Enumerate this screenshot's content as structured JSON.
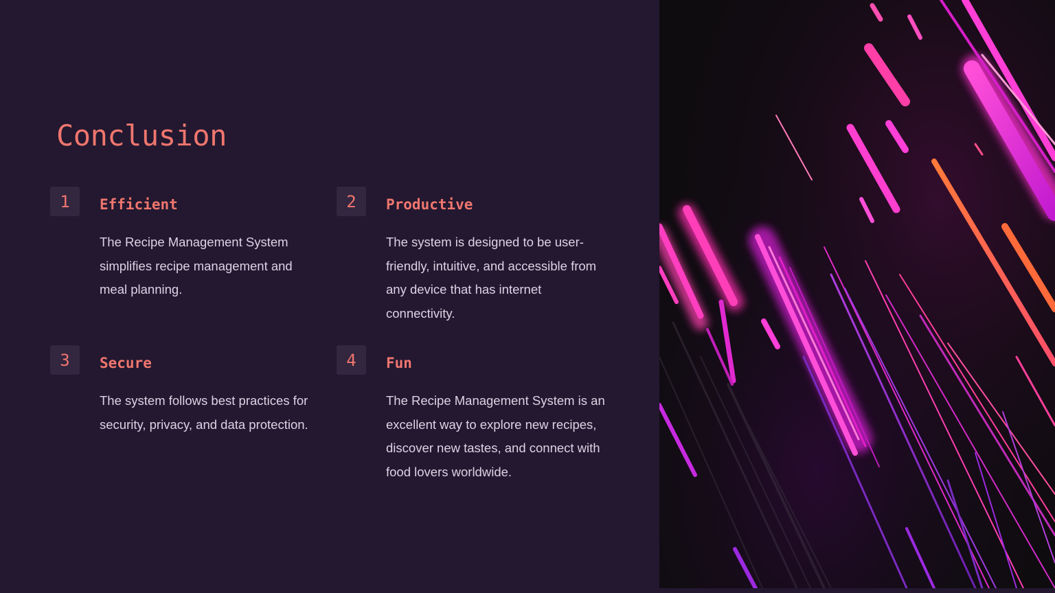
{
  "slide": {
    "title": "Conclusion",
    "items": [
      {
        "number": "1",
        "heading": "Efficient",
        "body": "The Recipe Management System simplifies recipe management and meal planning."
      },
      {
        "number": "2",
        "heading": "Productive",
        "body": "The system is designed to be user-friendly, intuitive, and accessible from any device that has internet connectivity."
      },
      {
        "number": "3",
        "heading": "Secure",
        "body": "The system follows best practices for security, privacy, and data protection."
      },
      {
        "number": "4",
        "heading": "Fun",
        "body": "The Recipe Management System is an excellent way to explore new recipes, discover new tastes, and connect with food lovers worldwide."
      }
    ]
  },
  "colors": {
    "background": "#231830",
    "accent": "#f0766e",
    "body_text": "#ddd3e4",
    "number_box": "#33263f"
  },
  "image": {
    "icon": "neon-light-streaks-image"
  }
}
